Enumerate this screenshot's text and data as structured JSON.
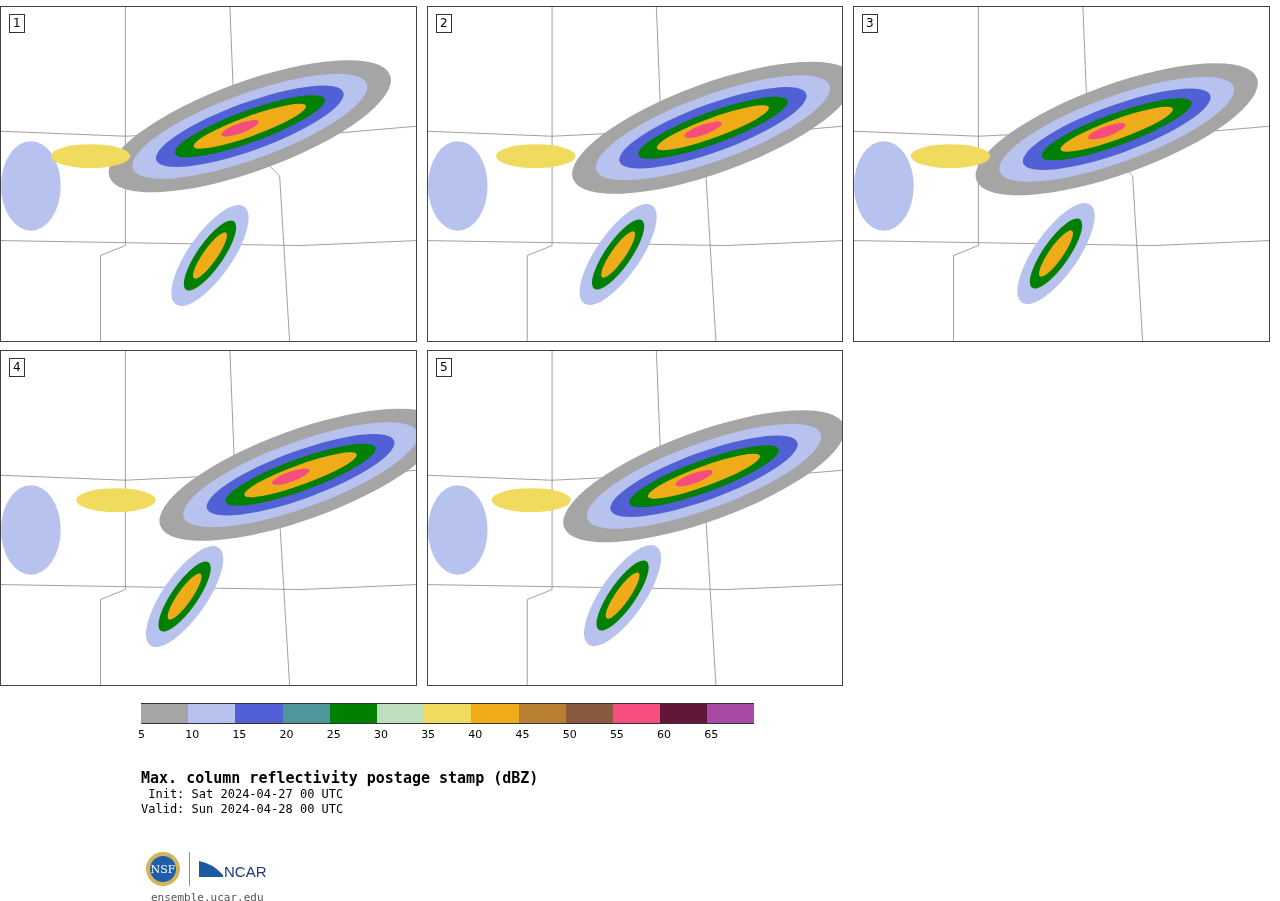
{
  "panels": [
    {
      "label": "1"
    },
    {
      "label": "2"
    },
    {
      "label": "3"
    },
    {
      "label": "4"
    },
    {
      "label": "5"
    }
  ],
  "colorbar": [
    {
      "label": "5",
      "color": "#a5a5a5"
    },
    {
      "label": "10",
      "color": "#b7c2ee"
    },
    {
      "label": "15",
      "color": "#5160d4"
    },
    {
      "label": "20",
      "color": "#4f969c"
    },
    {
      "label": "25",
      "color": "#008000"
    },
    {
      "label": "30",
      "color": "#c0dfc0"
    },
    {
      "label": "35",
      "color": "#f1db5e"
    },
    {
      "label": "40",
      "color": "#f0ac18"
    },
    {
      "label": "45",
      "color": "#b97f30"
    },
    {
      "label": "50",
      "color": "#8a5a3e"
    },
    {
      "label": "55",
      "color": "#f54e7e"
    },
    {
      "label": "60",
      "color": "#61173a"
    },
    {
      "label": "65",
      "color": "#a94aa6"
    }
  ],
  "title": "Max. column reflectivity postage stamp (dBZ)",
  "init": " Init: Sat 2024-04-27 00 UTC",
  "valid": "Valid: Sun 2024-04-28 00 UTC",
  "logo": {
    "nsf": "NSF",
    "ncar": "NCAR"
  },
  "url": "ensemble.ucar.edu"
}
